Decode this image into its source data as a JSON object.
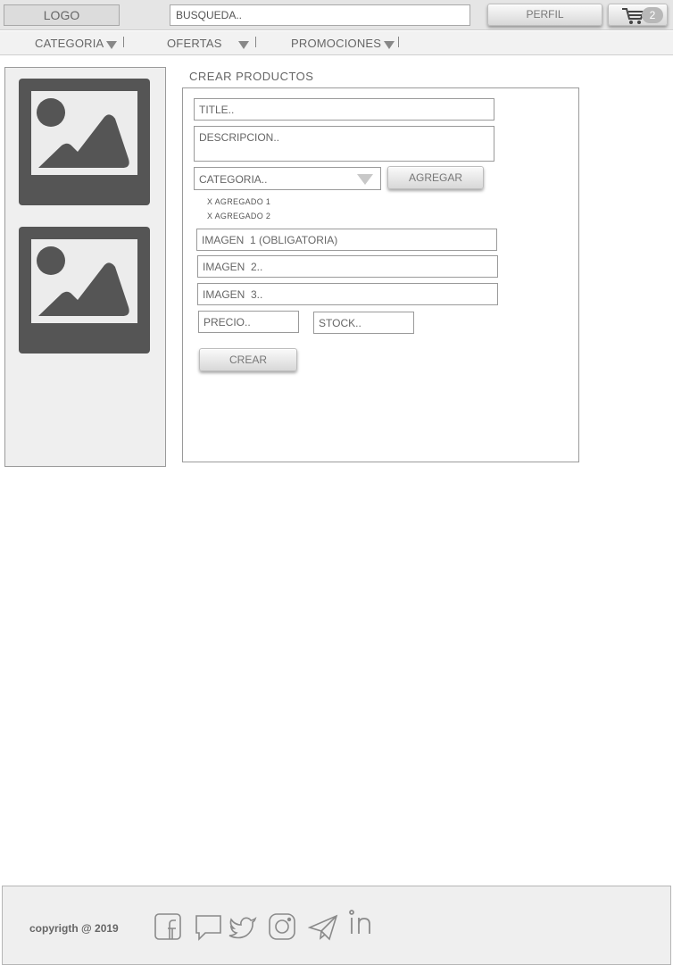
{
  "header": {
    "logo": "LOGO",
    "search_placeholder": "BUSQUEDA..",
    "profile_label": "PERFIL",
    "cart_count": "2"
  },
  "nav": {
    "items": [
      {
        "label": "CATEGORIA",
        "icon": "caret-down-icon"
      },
      {
        "label": "OFERTAS",
        "icon": "caret-down-icon"
      },
      {
        "label": "PROMOCIONES",
        "icon": "caret-down-icon"
      }
    ]
  },
  "sidebar": {
    "images": [
      "image-placeholder-icon",
      "image-placeholder-icon"
    ]
  },
  "form": {
    "title": "CREAR PRODUCTOS",
    "title_placeholder": "TITLE..",
    "description_placeholder": "DESCRIPCION..",
    "category_placeholder": "CATEGORIA..",
    "add_label": "AGREGAR",
    "added_items": [
      "X  AGREGADO  1",
      "X  AGREGADO  2"
    ],
    "image1_placeholder": "IMAGEN  1 (OBLIGATORIA)",
    "image2_placeholder": "IMAGEN  2..",
    "image3_placeholder": "IMAGEN  3..",
    "price_placeholder": "PRECIO..",
    "stock_placeholder": "STOCK..",
    "create_label": "CREAR"
  },
  "footer": {
    "copyright": "copyrigth @ 2019",
    "social_icons": [
      "facebook-icon",
      "chat-icon",
      "twitter-icon",
      "instagram-icon",
      "telegram-icon",
      "linkedin-icon"
    ]
  },
  "colors": {
    "header_bg": "#e5e5e5",
    "nav_bg": "#f2f2f2",
    "sidebar_bg": "#efefef",
    "image_placeholder": "#555555",
    "footer_bg": "#efefef",
    "border": "#9a9a9a"
  }
}
